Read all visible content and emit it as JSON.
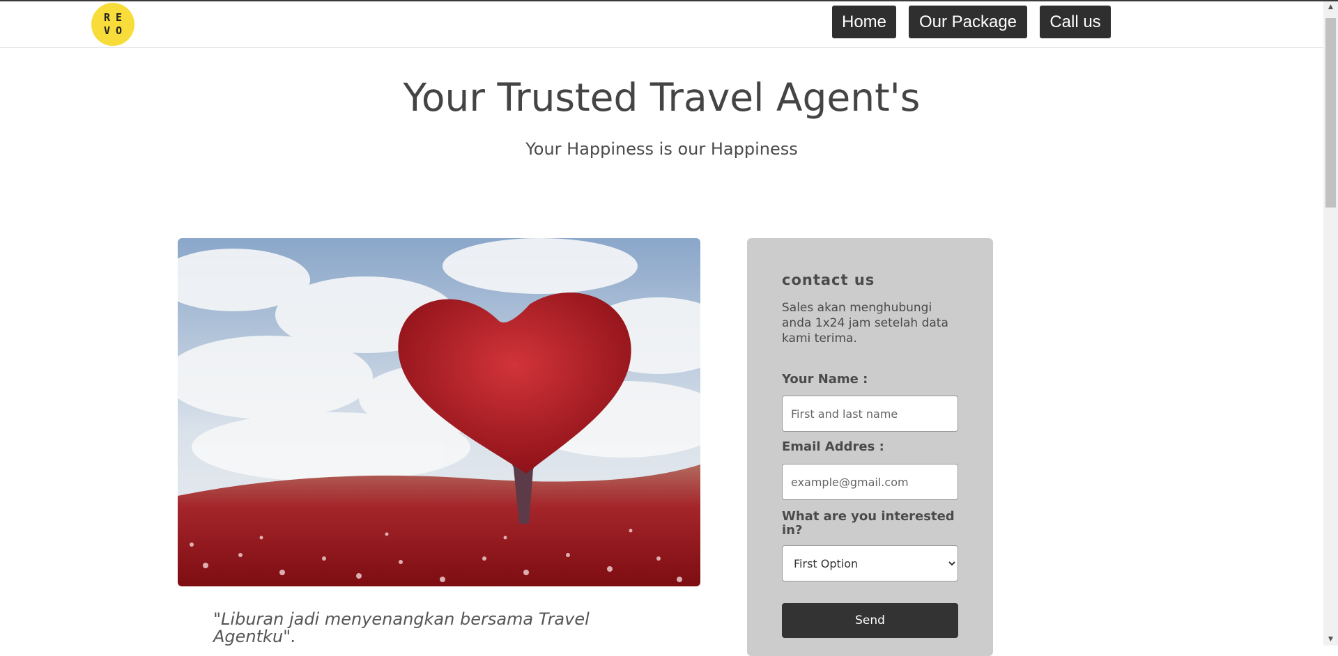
{
  "brand": {
    "logo_letters": [
      "R",
      "E",
      "V",
      "O"
    ]
  },
  "nav": {
    "home": "Home",
    "package": "Our Package",
    "call": "Call us"
  },
  "hero": {
    "title": "Your Trusted Travel Agent's",
    "subtitle": "Your Happiness is our Happiness"
  },
  "feature": {
    "quote": "\"Liburan jadi menyenangkan bersama Travel Agentku\"."
  },
  "contact": {
    "title": "contact us",
    "description": "Sales akan menghubungi anda 1x24 jam setelah data kami terima.",
    "name_label": "Your Name :",
    "name_placeholder": "First and last name",
    "email_label": "Email Addres :",
    "email_placeholder": "example@gmail.com",
    "interest_label": "What are you interested in?",
    "interest_selected": "First Option",
    "send_label": "Send"
  },
  "colors": {
    "nav_button": "#2f2f2f",
    "logo_yellow": "#f7dc3a",
    "card_bg": "#cccccc",
    "send_button": "#333333"
  },
  "icons": {
    "scroll_up": "triangle-up-icon",
    "scroll_down": "triangle-down-icon",
    "select_arrow": "chevron-down-icon"
  }
}
